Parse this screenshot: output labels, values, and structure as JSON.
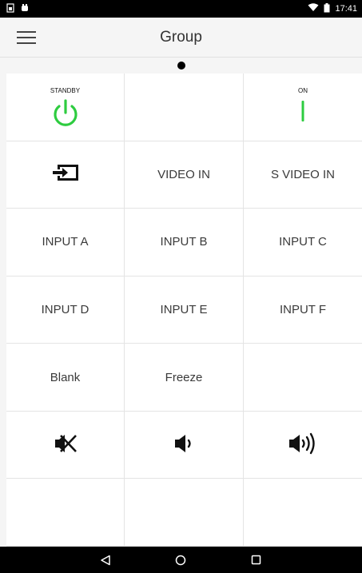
{
  "status_bar": {
    "time": "17:41",
    "left_icons": [
      "sim-icon",
      "notification-icon"
    ],
    "right_icons": [
      "wifi-icon",
      "battery-icon"
    ]
  },
  "app_bar": {
    "title": "Group",
    "menu_icon": "hamburger-menu-icon"
  },
  "page_indicator": {
    "current": 1,
    "total": 1
  },
  "grid": {
    "rows": [
      [
        {
          "name": "standby-button",
          "label": "STANDBY",
          "icon": "power-icon"
        },
        {
          "name": "empty-cell-1-2",
          "label": ""
        },
        {
          "name": "on-button",
          "label": "ON",
          "icon": "on-bar-icon"
        }
      ],
      [
        {
          "name": "input-select-button",
          "label": "",
          "icon": "input-icon"
        },
        {
          "name": "video-in-button",
          "label": "VIDEO IN"
        },
        {
          "name": "s-video-in-button",
          "label": "S VIDEO IN"
        }
      ],
      [
        {
          "name": "input-a-button",
          "label": "INPUT A"
        },
        {
          "name": "input-b-button",
          "label": "INPUT B"
        },
        {
          "name": "input-c-button",
          "label": "INPUT C"
        }
      ],
      [
        {
          "name": "input-d-button",
          "label": "INPUT D"
        },
        {
          "name": "input-e-button",
          "label": "INPUT E"
        },
        {
          "name": "input-f-button",
          "label": "INPUT F"
        }
      ],
      [
        {
          "name": "blank-button",
          "label": "Blank"
        },
        {
          "name": "freeze-button",
          "label": "Freeze"
        },
        {
          "name": "empty-cell-5-3",
          "label": ""
        }
      ],
      [
        {
          "name": "mute-button",
          "label": "",
          "icon": "mute-icon"
        },
        {
          "name": "volume-down-button",
          "label": "",
          "icon": "volume-down-icon"
        },
        {
          "name": "volume-up-button",
          "label": "",
          "icon": "volume-up-icon"
        }
      ],
      [
        {
          "name": "empty-cell-7-1",
          "label": ""
        },
        {
          "name": "empty-cell-7-2",
          "label": ""
        },
        {
          "name": "empty-cell-7-3",
          "label": ""
        }
      ]
    ]
  },
  "colors": {
    "power_green": "#2ecc40",
    "status_bar_bg": "#000000",
    "nav_bar_bg": "#000000"
  },
  "nav_bar": {
    "buttons": [
      "back-icon",
      "home-icon",
      "recents-icon"
    ]
  }
}
